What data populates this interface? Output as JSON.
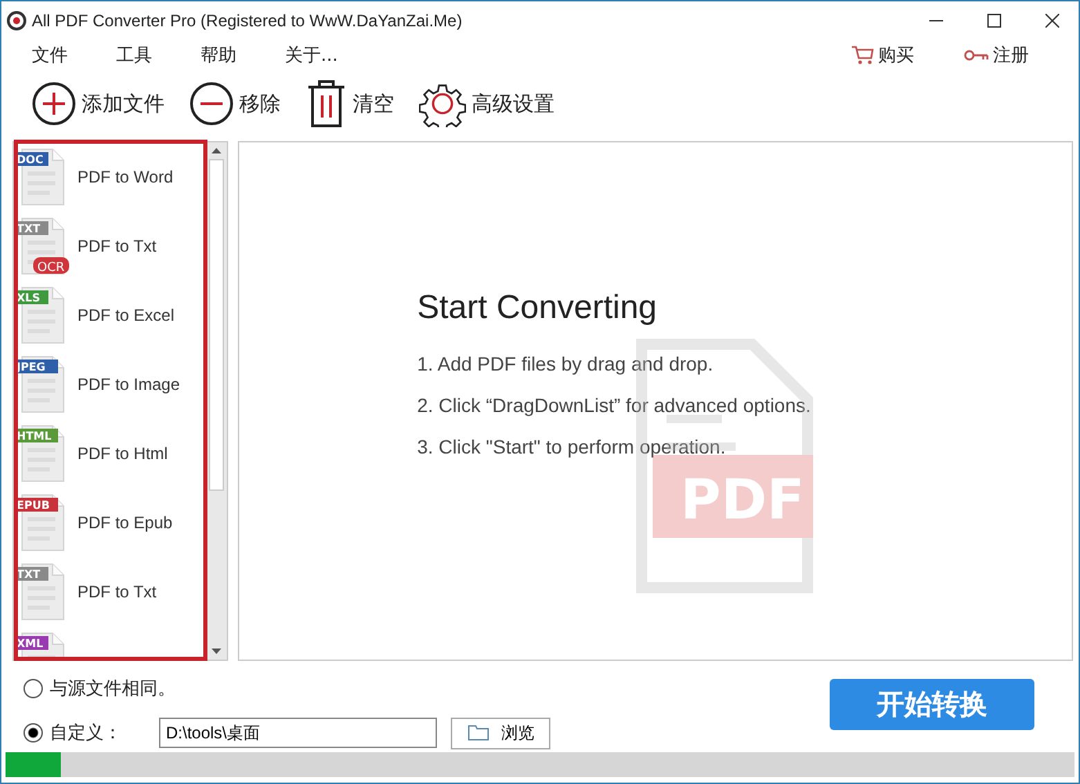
{
  "window": {
    "title": "All PDF Converter Pro (Registered to WwW.DaYanZai.Me)"
  },
  "menu": [
    "文件",
    "工具",
    "帮助",
    "关于..."
  ],
  "menu_right": [
    {
      "kind": "cart",
      "label": "购买"
    },
    {
      "kind": "key",
      "label": "注册"
    }
  ],
  "toolbar": [
    {
      "kind": "add",
      "label": "添加文件"
    },
    {
      "kind": "remove",
      "label": "移除"
    },
    {
      "kind": "trash",
      "label": "清空"
    },
    {
      "kind": "gear",
      "label": "高级设置"
    }
  ],
  "formats": [
    {
      "badge": "DOC",
      "color": "#2f5fa8",
      "label": "PDF to Word"
    },
    {
      "badge": "TXT",
      "color": "#8a8a8a",
      "label": "PDF to Txt",
      "extra": "OCR"
    },
    {
      "badge": "XLS",
      "color": "#3f9a3f",
      "label": "PDF to Excel"
    },
    {
      "badge": "JPEG",
      "color": "#2f5fa8",
      "label": "PDF to Image"
    },
    {
      "badge": "HTML",
      "color": "#5a9a3a",
      "label": "PDF to Html"
    },
    {
      "badge": "EPUB",
      "color": "#c8323a",
      "label": "PDF to Epub"
    },
    {
      "badge": "TXT",
      "color": "#8a8a8a",
      "label": "PDF to Txt"
    },
    {
      "badge": "XML",
      "color": "#9a3ab0"
    }
  ],
  "start": {
    "title": "Start Converting",
    "steps": [
      "1. Add PDF files by drag and drop.",
      "2. Click “DragDownList” for advanced options.",
      "3. Click \"Start\" to perform operation."
    ],
    "watermark": "PDF"
  },
  "output": [
    {
      "label": "与源文件相同。",
      "selected": false
    },
    {
      "label": "自定义：",
      "selected": true
    }
  ],
  "path": {
    "value": "D:\\tools\\桌面"
  },
  "browse": "浏览",
  "convert": "开始转换",
  "progress": {
    "level": 0.052
  }
}
